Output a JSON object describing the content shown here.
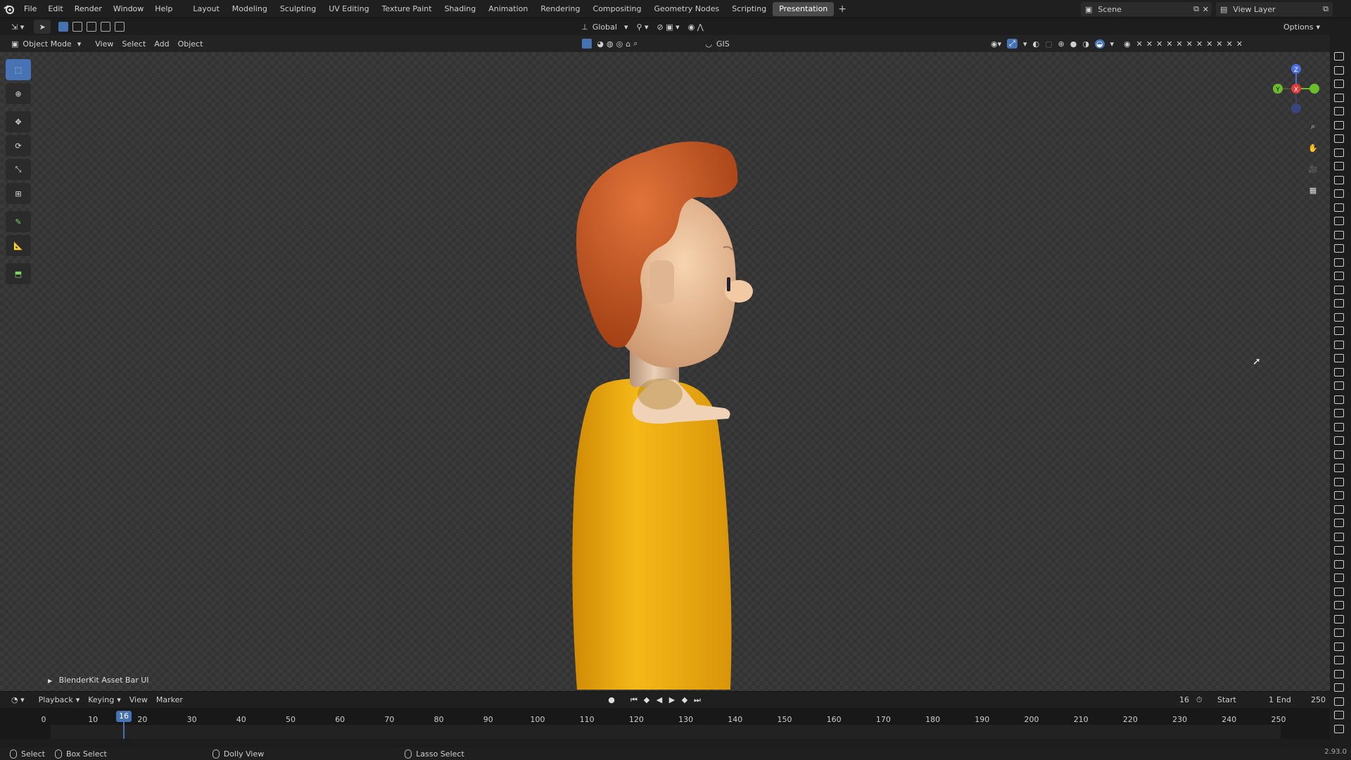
{
  "menu": {
    "file": "File",
    "edit": "Edit",
    "render": "Render",
    "window": "Window",
    "help": "Help"
  },
  "workspaces": [
    "Layout",
    "Modeling",
    "Sculpting",
    "UV Editing",
    "Texture Paint",
    "Shading",
    "Animation",
    "Rendering",
    "Compositing",
    "Geometry Nodes",
    "Scripting",
    "Presentation"
  ],
  "active_workspace": "Presentation",
  "scene": {
    "name": "Scene"
  },
  "view_layer": {
    "name": "View Layer"
  },
  "header": {
    "transform_orientation": "Global",
    "options": "Options"
  },
  "viewport_header": {
    "mode": "Object Mode",
    "view": "View",
    "select": "Select",
    "add": "Add",
    "object": "Object",
    "gis": "GIS"
  },
  "nav_gizmo": {
    "z": "Z",
    "x": "X",
    "y": "Y"
  },
  "assetbar_label": "BlenderKit Asset Bar UI",
  "timeline": {
    "playback": "Playback",
    "keying": "Keying",
    "view": "View",
    "marker": "Marker",
    "current_frame": "16",
    "start_label": "Start",
    "start": "1",
    "end_label": "End",
    "end": "250",
    "ticks": [
      "0",
      "10",
      "20",
      "30",
      "40",
      "50",
      "60",
      "70",
      "80",
      "90",
      "100",
      "110",
      "120",
      "130",
      "140",
      "150",
      "160",
      "170",
      "180",
      "190",
      "200",
      "210",
      "220",
      "230",
      "240",
      "250"
    ]
  },
  "statusbar": {
    "select": "Select",
    "box_select": "Box Select",
    "dolly_view": "Dolly View",
    "lasso_select": "Lasso Select",
    "version": "2.93.0"
  },
  "colors": {
    "accent": "#4772b3",
    "hair": "#c9541b",
    "sweater": "#e8a90e",
    "skin": "#f1caa0",
    "x_axis": "#e23a3a",
    "y_axis": "#6bbd2b",
    "z_axis": "#4d6de0"
  },
  "icons": [
    "blender-logo-icon",
    "select-box-icon",
    "cursor-icon",
    "move-icon",
    "rotate-icon",
    "scale-icon",
    "transform-icon",
    "annotate-icon",
    "measure-icon",
    "add-cube-icon",
    "zoom-icon",
    "hand-pan-icon",
    "camera-icon",
    "grid-icon",
    "camera-render-icon"
  ]
}
